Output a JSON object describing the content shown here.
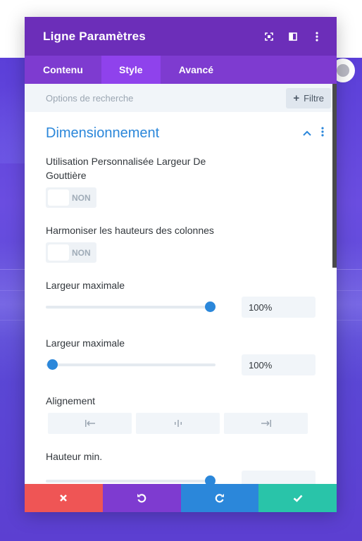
{
  "modal": {
    "title": "Ligne Paramètres",
    "tabs": [
      {
        "label": "Contenu",
        "active": false
      },
      {
        "label": "Style",
        "active": true
      },
      {
        "label": "Avancé",
        "active": false
      }
    ]
  },
  "search": {
    "placeholder": "Options de recherche",
    "filter_label": "Filtre"
  },
  "section": {
    "title": "Dimensionnement"
  },
  "fields": {
    "gutter": {
      "label": "Utilisation Personnalisée Largeur De Gouttière",
      "toggle": "NON"
    },
    "equalize": {
      "label": "Harmoniser les hauteurs des colonnes",
      "toggle": "NON"
    },
    "max_width_1": {
      "label": "Largeur maximale",
      "value": "100%",
      "slider_fraction": 1.0
    },
    "max_width_2": {
      "label": "Largeur maximale",
      "value": "100%",
      "slider_fraction": 0.0
    },
    "alignment": {
      "label": "Alignement",
      "options": [
        "left-align-icon",
        "center-align-icon",
        "right-align-icon"
      ]
    },
    "min_height": {
      "label": "Hauteur min.",
      "slider_fraction": 1.0
    }
  },
  "icons": {
    "header": [
      "expand-icon",
      "sidebar-icon",
      "more-vertical-icon"
    ],
    "section": [
      "chevron-up-icon",
      "more-vertical-icon"
    ],
    "footer": [
      "close-icon",
      "undo-icon",
      "redo-icon",
      "check-icon"
    ]
  },
  "colors": {
    "header": "#6c2eb9",
    "tabs": "#7e3bd0",
    "tab_active": "#8f42ec",
    "accent": "#2b87da",
    "cancel": "#ef5555",
    "undo": "#7e3bd0",
    "redo": "#2b87da",
    "save": "#29c4a9"
  }
}
